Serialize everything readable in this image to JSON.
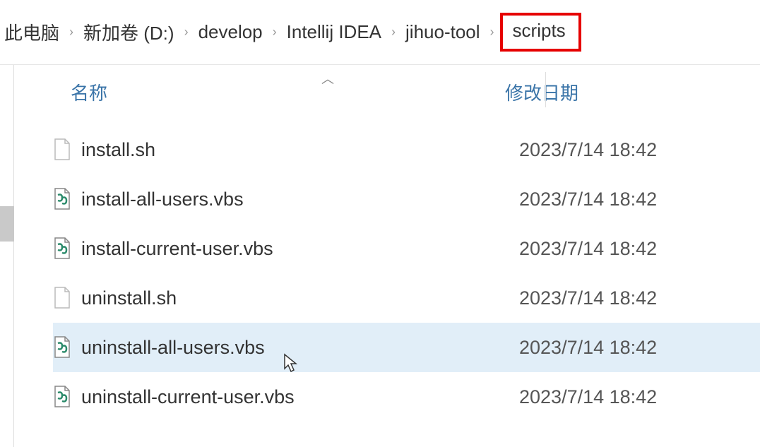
{
  "breadcrumb": {
    "items": [
      {
        "label": "此电脑"
      },
      {
        "label": "新加卷 (D:)"
      },
      {
        "label": "develop"
      },
      {
        "label": "Intellij IDEA"
      },
      {
        "label": "jihuo-tool"
      },
      {
        "label": "scripts",
        "highlighted": true
      }
    ],
    "separator": "›"
  },
  "columns": {
    "name": "名称",
    "date": "修改日期"
  },
  "files": [
    {
      "name": "install.sh",
      "date": "2023/7/14 18:42",
      "icon": "blank"
    },
    {
      "name": "install-all-users.vbs",
      "date": "2023/7/14 18:42",
      "icon": "vbs"
    },
    {
      "name": "install-current-user.vbs",
      "date": "2023/7/14 18:42",
      "icon": "vbs"
    },
    {
      "name": "uninstall.sh",
      "date": "2023/7/14 18:42",
      "icon": "blank"
    },
    {
      "name": "uninstall-all-users.vbs",
      "date": "2023/7/14 18:42",
      "icon": "vbs",
      "selected": true
    },
    {
      "name": "uninstall-current-user.vbs",
      "date": "2023/7/14 18:42",
      "icon": "vbs"
    }
  ]
}
